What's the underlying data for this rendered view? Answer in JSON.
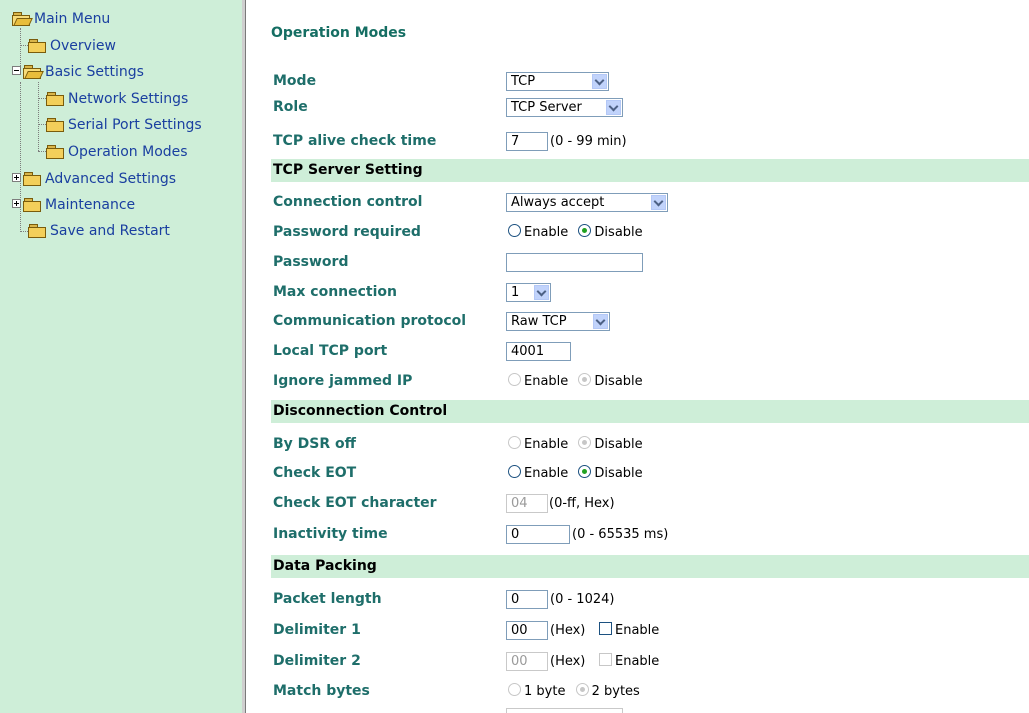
{
  "sidebar": {
    "items": [
      {
        "label": "Main Menu"
      },
      {
        "label": "Overview"
      },
      {
        "label": "Basic Settings"
      },
      {
        "label": "Network Settings"
      },
      {
        "label": "Serial Port Settings"
      },
      {
        "label": "Operation Modes"
      },
      {
        "label": "Advanced Settings"
      },
      {
        "label": "Maintenance"
      },
      {
        "label": "Save and Restart"
      }
    ]
  },
  "page_title": "Operation Modes",
  "fields": {
    "mode": {
      "label": "Mode",
      "value": "TCP"
    },
    "role": {
      "label": "Role",
      "value": "TCP Server"
    },
    "alive": {
      "label": "TCP alive check time",
      "value": "7",
      "hint": "(0 - 99 min)"
    },
    "conn_control": {
      "label": "Connection control",
      "value": "Always accept"
    },
    "pwd_required": {
      "label": "Password required",
      "opt1": "Enable",
      "opt2": "Disable"
    },
    "password": {
      "label": "Password",
      "value": ""
    },
    "max_conn": {
      "label": "Max connection",
      "value": "1"
    },
    "comm_protocol": {
      "label": "Communication protocol",
      "value": "Raw TCP"
    },
    "local_port": {
      "label": "Local TCP port",
      "value": "4001"
    },
    "ignore_jammed": {
      "label": "Ignore jammed IP",
      "opt1": "Enable",
      "opt2": "Disable"
    },
    "dsr_off": {
      "label": "By DSR off",
      "opt1": "Enable",
      "opt2": "Disable"
    },
    "check_eot": {
      "label": "Check EOT",
      "opt1": "Enable",
      "opt2": "Disable"
    },
    "eot_char": {
      "label": "Check EOT character",
      "value": "04",
      "hint": "(0-ff, Hex)"
    },
    "inactivity": {
      "label": "Inactivity time",
      "value": "0",
      "hint": "(0 - 65535 ms)"
    },
    "packet_len": {
      "label": "Packet length",
      "value": "0",
      "hint": "(0 - 1024)"
    },
    "delim1": {
      "label": "Delimiter 1",
      "value": "00",
      "hint": "(Hex)",
      "check": "Enable"
    },
    "delim2": {
      "label": "Delimiter 2",
      "value": "00",
      "hint": "(Hex)",
      "check": "Enable"
    },
    "match_bytes": {
      "label": "Match bytes",
      "opt1": "1 byte",
      "opt2": "2 bytes"
    }
  },
  "sections": {
    "tcp_server": "TCP Server Setting",
    "disconnect": "Disconnection Control",
    "packing": "Data Packing"
  },
  "colors": {
    "sidebar_bg": "#ceeed8",
    "label_teal": "#1e6e6a",
    "title_teal": "#156e63",
    "menu_blue": "#1a3fa0"
  }
}
